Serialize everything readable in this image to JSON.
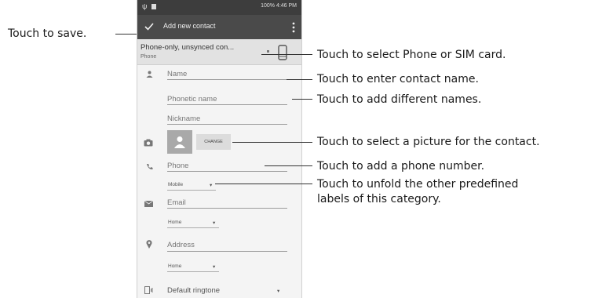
{
  "status_bar": {
    "right_text": "100% 4:46 PM"
  },
  "app_bar": {
    "title": "Add new contact"
  },
  "account": {
    "name": "Phone-only, unsynced con...",
    "type": "Phone"
  },
  "fields": {
    "name_placeholder": "Name",
    "phonetic_placeholder": "Phonetic name",
    "nickname_placeholder": "Nickname",
    "change_button": "CHANGE",
    "phone_placeholder": "Phone",
    "phone_label": "Mobile",
    "email_placeholder": "Email",
    "email_label": "Home",
    "address_placeholder": "Address",
    "address_label": "Home",
    "ringtone": "Default ringtone"
  },
  "callouts": {
    "save": "Touch to save.",
    "select_storage": "Touch to select Phone or SIM card.",
    "enter_name": "Touch to enter contact name.",
    "different_names": "Touch to add different names.",
    "select_picture": "Touch to select a picture for the contact.",
    "add_phone": "Touch to add a phone number.",
    "unfold_line1": "Touch to unfold the other predefined",
    "unfold_line2": "labels of this category."
  },
  "icons": {
    "save": "check-icon",
    "menu": "overflow-menu-icon",
    "storage": "phone-device-icon",
    "person": "person-icon",
    "camera": "camera-icon",
    "phone": "phone-icon",
    "email": "email-icon",
    "place": "place-icon",
    "ringtone": "ringtone-icon"
  }
}
